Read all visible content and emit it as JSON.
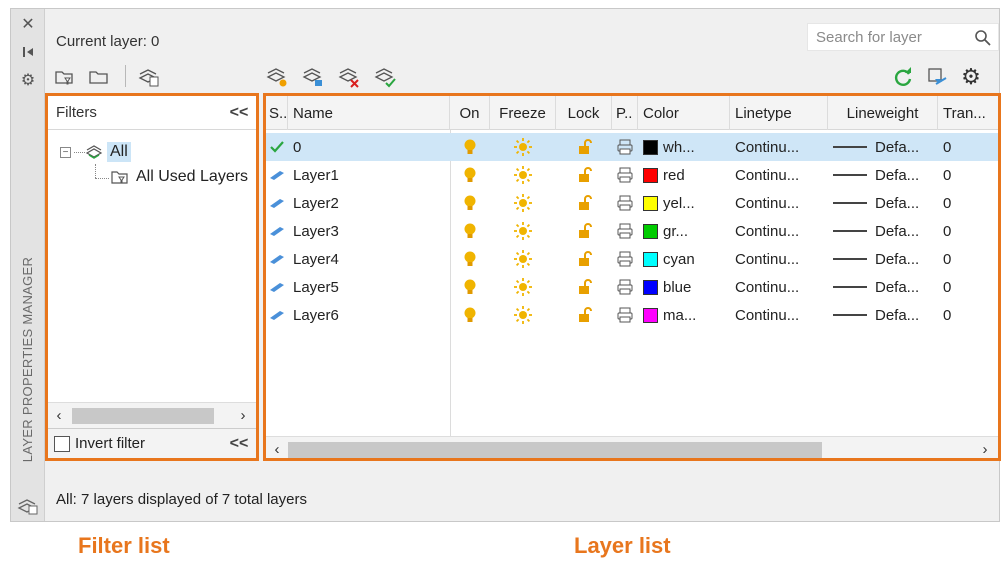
{
  "palette": {
    "title": "LAYER PROPERTIES MANAGER",
    "close_icon": "close-icon",
    "autohide_icon": "autohide-icon",
    "settings_icon": "gear-icon"
  },
  "header": {
    "current_layer": "Current layer: 0",
    "search_placeholder": "Search for layer"
  },
  "toolbar": {
    "left": [
      "new-property-filter-icon",
      "new-group-filter-icon",
      "layer-states-manager-icon"
    ],
    "layer_ops": [
      "new-layer-icon",
      "new-layer-vp-frozen-icon",
      "delete-layer-icon",
      "set-current-icon"
    ],
    "right": [
      "refresh-icon",
      "layer-settings-icon",
      "settings-icon"
    ]
  },
  "filters": {
    "heading": "Filters",
    "tree_root": "All",
    "tree_child": "All Used Layers",
    "invert_filter": "Invert filter",
    "collapse_glyph": "<<"
  },
  "columns": [
    "S..",
    "Name",
    "On",
    "Freeze",
    "Lock",
    "P..",
    "Color",
    "Linetype",
    "Lineweight",
    "Tran..."
  ],
  "layers": [
    {
      "name": "0",
      "current": true,
      "color_name": "wh...",
      "color_hex": "#000000",
      "linetype": "Continu...",
      "lineweight": "Defa...",
      "transparency": "0"
    },
    {
      "name": "Layer1",
      "current": false,
      "color_name": "red",
      "color_hex": "#ff0000",
      "linetype": "Continu...",
      "lineweight": "Defa...",
      "transparency": "0"
    },
    {
      "name": "Layer2",
      "current": false,
      "color_name": "yel...",
      "color_hex": "#ffff00",
      "linetype": "Continu...",
      "lineweight": "Defa...",
      "transparency": "0"
    },
    {
      "name": "Layer3",
      "current": false,
      "color_name": "gr...",
      "color_hex": "#00cc00",
      "linetype": "Continu...",
      "lineweight": "Defa...",
      "transparency": "0"
    },
    {
      "name": "Layer4",
      "current": false,
      "color_name": "cyan",
      "color_hex": "#00ffff",
      "linetype": "Continu...",
      "lineweight": "Defa...",
      "transparency": "0"
    },
    {
      "name": "Layer5",
      "current": false,
      "color_name": "blue",
      "color_hex": "#0000ff",
      "linetype": "Continu...",
      "lineweight": "Defa...",
      "transparency": "0"
    },
    {
      "name": "Layer6",
      "current": false,
      "color_name": "ma...",
      "color_hex": "#ff00ff",
      "linetype": "Continu...",
      "lineweight": "Defa...",
      "transparency": "0"
    }
  ],
  "status_text": "All: 7 layers displayed of 7 total layers",
  "callouts": {
    "filter_list": "Filter list",
    "layer_list": "Layer list"
  },
  "colors": {
    "accent_orange": "#e8761d",
    "current_row": "#cfe6f7",
    "bulb": "#f0b400",
    "lock": "#e8a000"
  }
}
